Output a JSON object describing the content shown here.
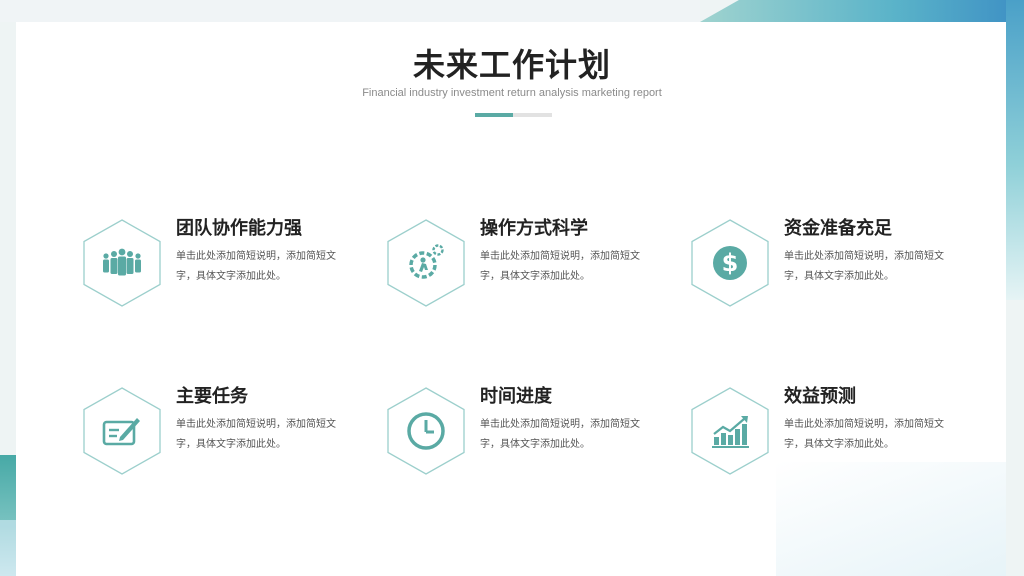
{
  "slide": {
    "title": "未来工作计划",
    "subtitle": "Financial industry investment return analysis marketing report"
  },
  "colors": {
    "accent": "#5aaaa4",
    "hex_border": "#9ccfcc",
    "icon": "#5aaaa4"
  },
  "features": [
    {
      "icon": "team-icon",
      "title": "团队协作能力强",
      "desc": "单击此处添加简短说明，添加简短文字，具体文字添加此处。"
    },
    {
      "icon": "gear-operation-icon",
      "title": "操作方式科学",
      "desc": "单击此处添加简短说明，添加简短文字，具体文字添加此处。"
    },
    {
      "icon": "dollar-icon",
      "title": "资金准备充足",
      "desc": "单击此处添加简短说明，添加简短文字，具体文字添加此处。"
    },
    {
      "icon": "signature-icon",
      "title": "主要任务",
      "desc": "单击此处添加简短说明，添加简短文字，具体文字添加此处。"
    },
    {
      "icon": "clock-icon",
      "title": "时间进度",
      "desc": "单击此处添加简短说明，添加简短文字，具体文字添加此处。"
    },
    {
      "icon": "growth-chart-icon",
      "title": "效益预测",
      "desc": "单击此处添加简短说明，添加简短文字，具体文字添加此处。"
    }
  ]
}
